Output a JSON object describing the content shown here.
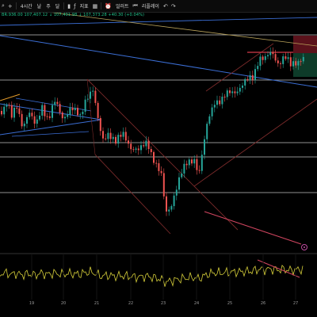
{
  "toolbar": {
    "symbol_truncated": "",
    "interval": "4시간",
    "ranges": [
      "날",
      "주",
      "달"
    ],
    "indicators_label": "지표",
    "alerts_label": "얼러트",
    "replay_label": "리플레이"
  },
  "ohlc_text": "BR:936.00 107,407.12 ↓ 107,491.98 ↓ 107,373.28 +40.30 (+0.04%)",
  "time_axis": {
    "labels": [
      "19",
      "20",
      "21",
      "22",
      "23",
      "24",
      "25",
      "26",
      "27"
    ]
  },
  "colors": {
    "background": "#000000",
    "up_candle": "#26a69a",
    "down_candle": "#ef5350",
    "trendline_blue": "#3b6ed4",
    "trendline_orange": "#e39a2a",
    "horizontal_level": "#bfbfbf",
    "channel": "#7a2a2a",
    "oscillator": "#d6cf3a"
  },
  "icons": [
    "search-icon",
    "plus-icon",
    "candles-icon",
    "indicators-icon",
    "layout-icon",
    "alert-icon",
    "replay-icon",
    "undo-icon",
    "redo-icon"
  ]
}
